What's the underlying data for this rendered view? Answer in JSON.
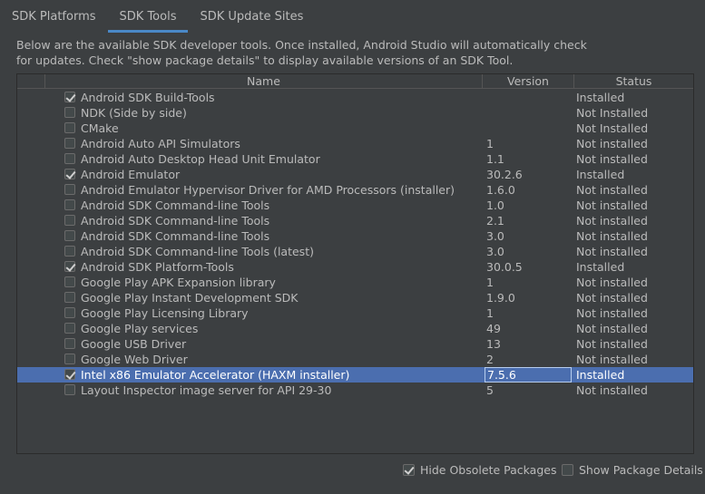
{
  "tabs": [
    {
      "label": "SDK Platforms",
      "active": false
    },
    {
      "label": "SDK Tools",
      "active": true
    },
    {
      "label": "SDK Update Sites",
      "active": false
    }
  ],
  "description": {
    "line1": "Below are the available SDK developer tools. Once installed, Android Studio will automatically check",
    "line2": "for updates. Check \"show package details\" to display available versions of an SDK Tool."
  },
  "table": {
    "headers": {
      "name": "Name",
      "version": "Version",
      "status": "Status"
    },
    "rows": [
      {
        "checked": true,
        "name": "Android SDK Build-Tools",
        "version": "",
        "status": "Installed"
      },
      {
        "checked": false,
        "name": "NDK (Side by side)",
        "version": "",
        "status": "Not Installed"
      },
      {
        "checked": false,
        "name": "CMake",
        "version": "",
        "status": "Not Installed"
      },
      {
        "checked": false,
        "name": "Android Auto API Simulators",
        "version": "1",
        "status": "Not installed"
      },
      {
        "checked": false,
        "name": "Android Auto Desktop Head Unit Emulator",
        "version": "1.1",
        "status": "Not installed"
      },
      {
        "checked": true,
        "name": "Android Emulator",
        "version": "30.2.6",
        "status": "Installed"
      },
      {
        "checked": false,
        "name": "Android Emulator Hypervisor Driver for AMD Processors (installer)",
        "version": "1.6.0",
        "status": "Not installed"
      },
      {
        "checked": false,
        "name": "Android SDK Command-line Tools",
        "version": "1.0",
        "status": "Not installed"
      },
      {
        "checked": false,
        "name": "Android SDK Command-line Tools",
        "version": "2.1",
        "status": "Not installed"
      },
      {
        "checked": false,
        "name": "Android SDK Command-line Tools",
        "version": "3.0",
        "status": "Not installed"
      },
      {
        "checked": false,
        "name": "Android SDK Command-line Tools (latest)",
        "version": "3.0",
        "status": "Not installed"
      },
      {
        "checked": true,
        "name": "Android SDK Platform-Tools",
        "version": "30.0.5",
        "status": "Installed"
      },
      {
        "checked": false,
        "name": "Google Play APK Expansion library",
        "version": "1",
        "status": "Not installed"
      },
      {
        "checked": false,
        "name": "Google Play Instant Development SDK",
        "version": "1.9.0",
        "status": "Not installed"
      },
      {
        "checked": false,
        "name": "Google Play Licensing Library",
        "version": "1",
        "status": "Not installed"
      },
      {
        "checked": false,
        "name": "Google Play services",
        "version": "49",
        "status": "Not installed"
      },
      {
        "checked": false,
        "name": "Google USB Driver",
        "version": "13",
        "status": "Not installed"
      },
      {
        "checked": false,
        "name": "Google Web Driver",
        "version": "2",
        "status": "Not installed"
      },
      {
        "checked": true,
        "name": "Intel x86 Emulator Accelerator (HAXM installer)",
        "version": "7.5.6",
        "status": "Installed",
        "selected": true
      },
      {
        "checked": false,
        "name": "Layout Inspector image server for API 29-30",
        "version": "5",
        "status": "Not installed"
      }
    ]
  },
  "options": {
    "hide_obsolete": {
      "label": "Hide Obsolete Packages",
      "checked": true
    },
    "show_details": {
      "label": "Show Package Details",
      "checked": false
    }
  },
  "colors": {
    "background": "#3c3f41",
    "selection": "#4b6eaf",
    "tab_underline": "#4a88c7",
    "text": "#bbbbbb"
  }
}
